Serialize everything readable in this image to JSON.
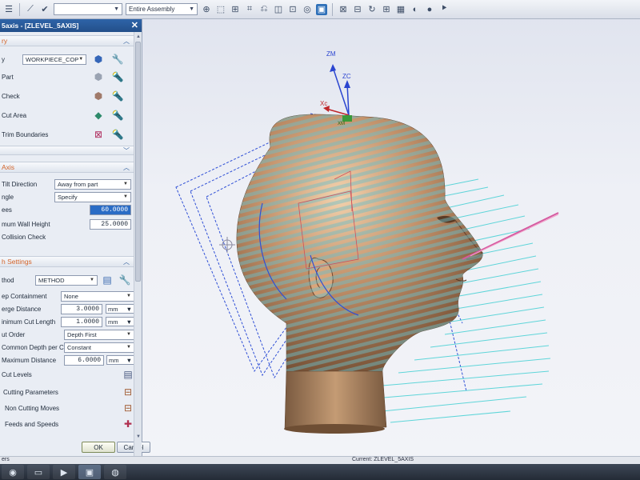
{
  "toolbar": {
    "filter_select": {
      "value": ""
    },
    "assembly_select": {
      "value": "Entire Assembly"
    },
    "icons": [
      "menu-icon",
      "snap-icon",
      "check-icon",
      "select-icon",
      "orient-icon",
      "view-icon",
      "lasso-icon",
      "layer-icon",
      "shade-icon",
      "render-icon",
      "fit-icon",
      "rotate-icon",
      "section-icon",
      "display-icon",
      "sphere-icon",
      "triad-icon"
    ]
  },
  "dialog": {
    "title": "5axis - [ZLEVEL_5AXIS]",
    "geometry": {
      "header": "ry",
      "geometry_label": "y",
      "geometry_value": "WORKPIECE_COP",
      "part_label": "Part",
      "check_label": "Check",
      "cut_area_label": "Cut Area",
      "trim_label": "Trim Boundaries"
    },
    "axis": {
      "header": "Axis",
      "tilt_direction_label": "Tilt Direction",
      "tilt_direction_value": "Away from part",
      "angle_label": "ngle",
      "angle_value": "Specify",
      "degrees_label": "ees",
      "degrees_value": "60.0000",
      "min_wall_label": "mum Wall Height",
      "min_wall_value": "25.0000",
      "collision_label": "Collision Check"
    },
    "path": {
      "header": "h Settings",
      "method_label": "thod",
      "method_value": "METHOD",
      "steep_label": "ep Containment",
      "steep_value": "None",
      "merge_label": "erge Distance",
      "merge_value": "3.0000",
      "merge_unit": "mm",
      "min_cut_label": "inimum Cut Length",
      "min_cut_value": "1.0000",
      "min_cut_unit": "mm",
      "cut_order_label": "ut Order",
      "cut_order_value": "Depth First",
      "common_depth_label": "Common Depth per Cut",
      "common_depth_value": "Constant",
      "max_distance_label": "Maximum Distance",
      "max_distance_value": "6.0000",
      "max_distance_unit": "mm",
      "cut_levels_label": "Cut Levels",
      "cutting_params_label": "Cutting Parameters",
      "non_cutting_label": "Non Cutting Moves",
      "feeds_label": "Feeds and Speeds"
    },
    "ok_label": "OK",
    "cancel_label": "Cancel"
  },
  "viewport": {
    "axis_zm": "ZM",
    "axis_zc": "ZC",
    "axis_xc": "Xc",
    "axis_ym": "YM",
    "axis_xm": "XM"
  },
  "status": {
    "left_text": "ers",
    "center_text": "Current: ZLEVEL_5AXIS"
  },
  "colors": {
    "dialog_title_bg": "#2e64a8",
    "section_header_text": "#d4642a",
    "highlight_field": "#2a6cc5",
    "head_surface": "#b88a63",
    "toolpath_lines": "#4fd2d6",
    "toolpath_blue": "#2f4fd6",
    "tool_axis": "#d55aa0"
  }
}
